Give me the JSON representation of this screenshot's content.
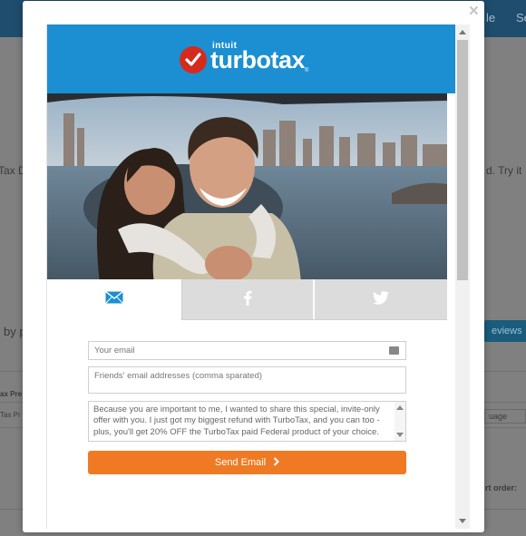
{
  "background": {
    "nav": [
      "le",
      "Se"
    ],
    "intro_left": "Tax D",
    "intro_right": "d. Try it",
    "by_text": "by p",
    "reviews_button": "eviews",
    "col_header": "ax Pre",
    "col_cell": "Tax Pr",
    "select_value": "uage",
    "sort_label": "rt order:"
  },
  "modal": {
    "close_label": "×",
    "brand": {
      "intuit": "intuit",
      "name": "turbotax",
      "reg": "®"
    },
    "tabs": [
      {
        "name": "email",
        "icon": "envelope-icon"
      },
      {
        "name": "facebook",
        "icon": "facebook-icon"
      },
      {
        "name": "twitter",
        "icon": "twitter-icon"
      }
    ],
    "form": {
      "email_placeholder": "Your email",
      "friends_placeholder": "Friends' email addresses (comma sparated)",
      "message": "Because you are important to me, I wanted to share this special, invite-only offer with you. I just got my biggest refund with TurboTax, and you can too - plus, you'll get 20% OFF the TurboTax paid Federal product of your choice.",
      "send_label": "Send Email"
    }
  },
  "colors": {
    "banner": "#1b8fd2",
    "accent_orange": "#f07a24",
    "check_red": "#d52b1e",
    "tab_active_icon": "#1b8fd2",
    "tab_inactive_icon": "#ffffff"
  }
}
